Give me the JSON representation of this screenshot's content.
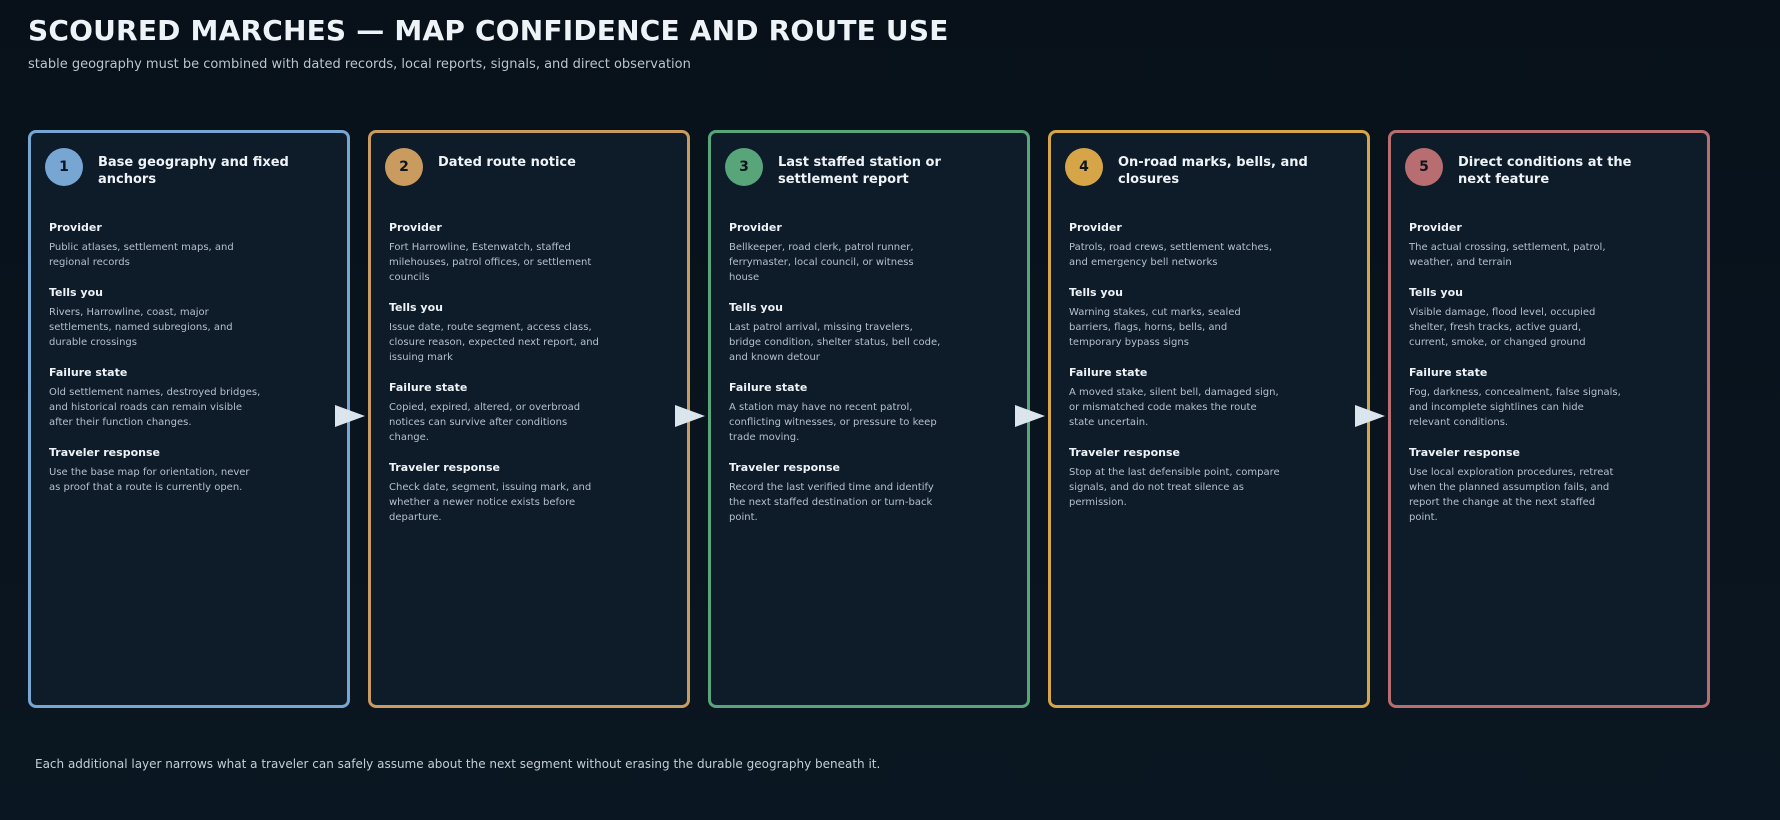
{
  "header": {
    "title": "SCOURED MARCHES — MAP CONFIDENCE AND ROUTE USE",
    "subtitle": "stable geography must be combined with dated records, local reports, signals, and direct observation"
  },
  "section_labels": {
    "provider": "Provider",
    "tells": "Tells you",
    "failure": "Failure state",
    "response": "Traveler response"
  },
  "panels": [
    {
      "number": "1",
      "title": "Base geography and fixed anchors",
      "color": "#78a6d3",
      "provider": "Public atlases, settlement maps, and regional records",
      "tells": "Rivers, Harrowline, coast, major settlements, named subregions, and durable crossings",
      "failure": "Old settlement names, destroyed bridges, and historical roads can remain visible after their function changes.",
      "response": "Use the base map for orientation, never as proof that a route is currently open."
    },
    {
      "number": "2",
      "title": "Dated route notice",
      "color": "#c99b5f",
      "provider": "Fort Harrowline, Estenwatch, staffed milehouses, patrol offices, or settlement councils",
      "tells": "Issue date, route segment, access class, closure reason, expected next report, and issuing mark",
      "failure": "Copied, expired, altered, or overbroad notices can survive after conditions change.",
      "response": "Check date, segment, issuing mark, and whether a newer notice exists before departure."
    },
    {
      "number": "3",
      "title": "Last staffed station or settlement report",
      "color": "#58a57a",
      "provider": "Bellkeeper, road clerk, patrol runner, ferrymaster, local council, or witness house",
      "tells": "Last patrol arrival, missing travelers, bridge condition, shelter status, bell code, and known detour",
      "failure": "A station may have no recent patrol, conflicting witnesses, or pressure to keep trade moving.",
      "response": "Record the last verified time and identify the next staffed destination or turn-back point."
    },
    {
      "number": "4",
      "title": "On-road marks, bells, and closures",
      "color": "#d6a548",
      "provider": "Patrols, road crews, settlement watches, and emergency bell networks",
      "tells": "Warning stakes, cut marks, sealed barriers, flags, horns, bells, and temporary bypass signs",
      "failure": "A moved stake, silent bell, damaged sign, or mismatched code makes the route state uncertain.",
      "response": "Stop at the last defensible point, compare signals, and do not treat silence as permission."
    },
    {
      "number": "5",
      "title": "Direct conditions at the next feature",
      "color": "#b86e70",
      "provider": "The actual crossing, settlement, patrol, weather, and terrain",
      "tells": "Visible damage, flood level, occupied shelter, fresh tracks, active guard, current, smoke, or changed ground",
      "failure": "Fog, darkness, concealment, false signals, and incomplete sightlines can hide relevant conditions.",
      "response": "Use local exploration procedures, retreat when the planned assumption fails, and report the change at the next staffed point."
    }
  ],
  "footer": "Each additional layer narrows what a traveler can safely assume about the next segment without erasing the durable geography beneath it."
}
